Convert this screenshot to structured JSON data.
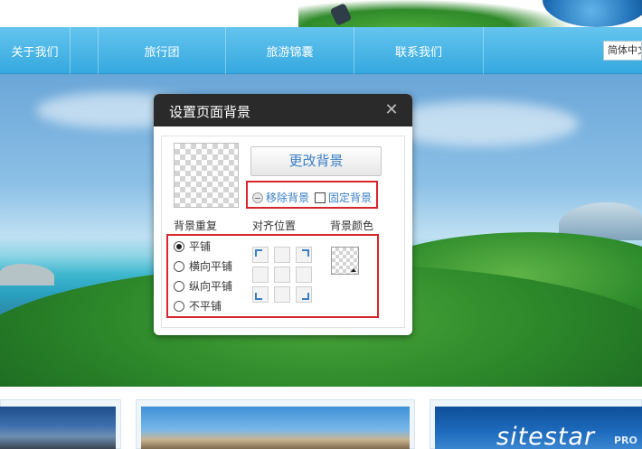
{
  "nav": {
    "items": [
      {
        "label": "关于我们"
      },
      {
        "label": "旅行团"
      },
      {
        "label": "旅游锦囊"
      },
      {
        "label": "联系我们"
      }
    ],
    "language": "简体中文"
  },
  "dialog": {
    "title": "设置页面背景",
    "change_button": "更改背景",
    "remove_label": "移除背景",
    "fix_label": "固定背景",
    "repeat_label": "背景重复",
    "align_label": "对齐位置",
    "color_label": "背景颜色",
    "repeat_options": [
      {
        "label": "平铺",
        "checked": true
      },
      {
        "label": "横向平铺",
        "checked": false
      },
      {
        "label": "纵向平铺",
        "checked": false
      },
      {
        "label": "不平铺",
        "checked": false
      }
    ]
  },
  "bottom": {
    "brand": "sitestar",
    "brand_sub": "PRO"
  }
}
